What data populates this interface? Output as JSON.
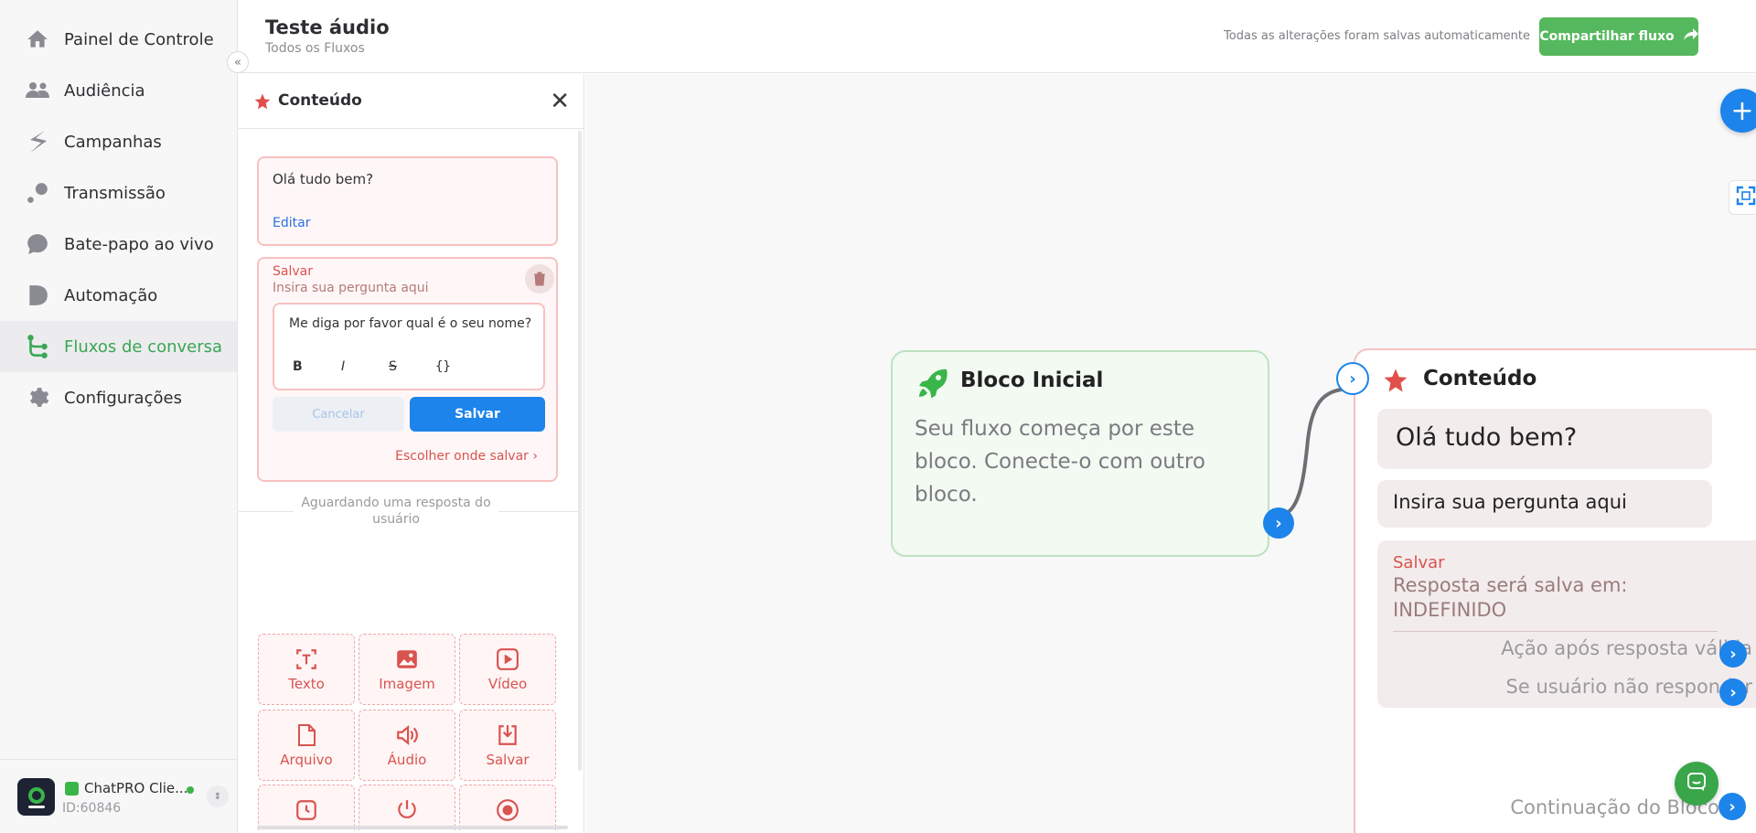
{
  "sidebar": {
    "items": [
      {
        "label": "Painel de Controle",
        "icon": "home-icon"
      },
      {
        "label": "Audiência",
        "icon": "users-icon"
      },
      {
        "label": "Campanhas",
        "icon": "campaign-icon"
      },
      {
        "label": "Transmissão",
        "icon": "broadcast-icon"
      },
      {
        "label": "Bate-papo ao vivo",
        "icon": "chat-icon"
      },
      {
        "label": "Automação",
        "icon": "automation-icon"
      },
      {
        "label": "Fluxos de conversa",
        "icon": "flow-icon",
        "active": true
      },
      {
        "label": "Configurações",
        "icon": "gear-icon"
      }
    ],
    "account": {
      "name": "ChatPRO Clie...",
      "id": "ID:60846"
    }
  },
  "header": {
    "title": "Teste áudio",
    "subtitle": "Todos os Fluxos",
    "autosave": "Todas as alterações foram salvas automaticamente",
    "share_label": "Compartilhar fluxo"
  },
  "panel": {
    "title": "Conteúdo",
    "message": {
      "text": "Olá tudo bem?",
      "edit_label": "Editar"
    },
    "question": {
      "label": "Salvar",
      "placeholder": "Insira sua pergunta aqui",
      "editor_text": "Me diga por favor qual é o seu nome?",
      "format_buttons": [
        "B",
        "I",
        "S",
        "{}"
      ],
      "cancel_label": "Cancelar",
      "save_label": "Salvar",
      "choose_label": "Escolher onde salvar"
    },
    "waiting_text": "Aguardando uma resposta do usuário",
    "tools": [
      {
        "label": "Texto",
        "icon": "text-icon"
      },
      {
        "label": "Imagem",
        "icon": "image-icon"
      },
      {
        "label": "Vídeo",
        "icon": "video-icon"
      },
      {
        "label": "Arquivo",
        "icon": "file-icon"
      },
      {
        "label": "Áudio",
        "icon": "audio-icon"
      },
      {
        "label": "Salvar",
        "icon": "download-icon"
      },
      {
        "label": "",
        "icon": "clock-icon"
      },
      {
        "label": "",
        "icon": "power-icon"
      },
      {
        "label": "",
        "icon": "record-icon"
      }
    ]
  },
  "canvas": {
    "start_block": {
      "title": "Bloco Inicial",
      "description": "Seu fluxo começa por este bloco. Conecte-o com outro bloco."
    },
    "content_block": {
      "title": "Conteúdo",
      "message": "Olá tudo bem?",
      "question": "Insira sua pergunta aqui",
      "save_label": "Salvar",
      "save_value": "Resposta será salva em: INDEFINIDO",
      "valid_action": "Ação após resposta válida",
      "no_response": "Se usuário não responder",
      "continuation": "Continuação do Bloco"
    }
  },
  "colors": {
    "accent_blue": "#1c84ea",
    "accent_green": "#56b85e",
    "accent_red": "#d9534f"
  }
}
